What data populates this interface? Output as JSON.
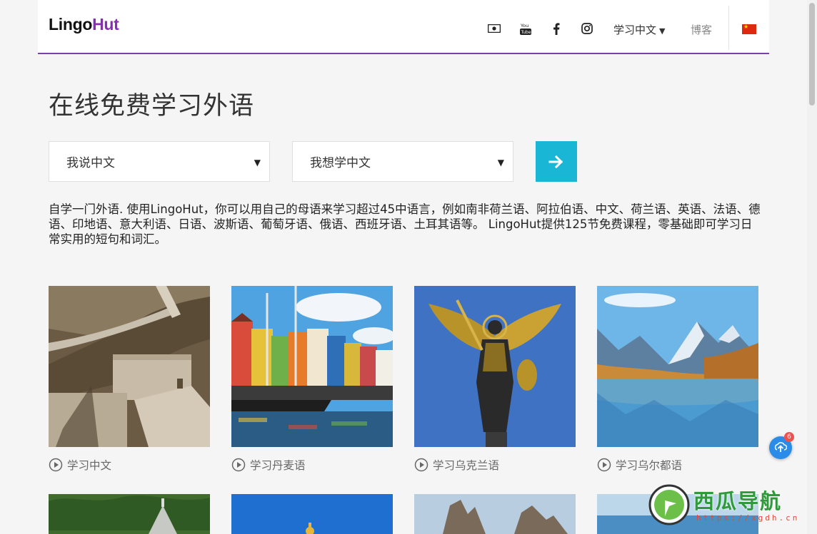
{
  "header": {
    "logo_lingo": "Lingo",
    "logo_hut": "Hut",
    "language_selector": "学习中文",
    "blog": "博客",
    "icons": [
      "money-icon",
      "youtube-icon",
      "facebook-icon",
      "instagram-icon",
      "china-flag-icon"
    ],
    "youtube_text": "You"
  },
  "main": {
    "title": "在线免费学习外语",
    "speak_select": "我说中文",
    "learn_select": "我想学中文",
    "intro": "自学一门外语. 使用LingoHut，你可以用自己的母语来学习超过45中语言，例如南非荷兰语、阿拉伯语、中文、荷兰语、英语、法语、德语、印地语、意大利语、日语、波斯语、葡萄牙语、俄语、西班牙语、土耳其语等。 LingoHut提供125节免费课程，零基础即可学习日常实用的短句和词汇。"
  },
  "cards": [
    {
      "label": "学习中文"
    },
    {
      "label": "学习丹麦语"
    },
    {
      "label": "学习乌克兰语"
    },
    {
      "label": "学习乌尔都语"
    }
  ],
  "notification": {
    "count": "6"
  },
  "watermark": {
    "text": "西瓜导航",
    "url": "https://xgdh.cn"
  },
  "colors": {
    "accent": "#7b3fa6",
    "button": "#1ab6d6"
  }
}
